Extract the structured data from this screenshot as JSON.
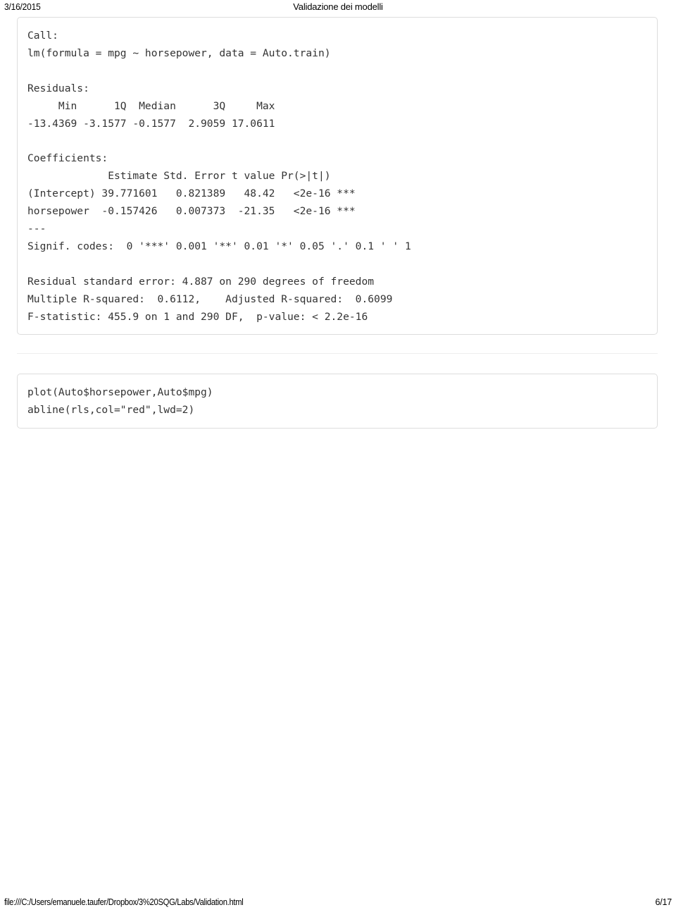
{
  "header": {
    "date": "3/16/2015",
    "title": "Validazione dei modelli"
  },
  "blocks": {
    "regression_output": "Call:\nlm(formula = mpg ~ horsepower, data = Auto.train)\n\nResiduals:\n     Min      1Q  Median      3Q     Max \n-13.4369 -3.1577 -0.1577  2.9059 17.0611 \n\nCoefficients:\n             Estimate Std. Error t value Pr(>|t|)    \n(Intercept) 39.771601   0.821389   48.42   <2e-16 ***\nhorsepower  -0.157426   0.007373  -21.35   <2e-16 ***\n---\nSignif. codes:  0 '***' 0.001 '**' 0.01 '*' 0.05 '.' 0.1 ' ' 1\n\nResidual standard error: 4.887 on 290 degrees of freedom\nMultiple R-squared:  0.6112,\tAdjusted R-squared:  0.6099 \nF-statistic: 455.9 on 1 and 290 DF,  p-value: < 2.2e-16",
    "plot_code": "plot(Auto$horsepower,Auto$mpg)\nabline(rls,col=\"red\",lwd=2)"
  },
  "footer": {
    "url": "file:///C:/Users/emanuele.taufer/Dropbox/3%20SQG/Labs/Validation.html",
    "page": "6/17"
  },
  "colors": {
    "code_text": "#333333",
    "block_border": "#dddddd",
    "rule": "#eeeeee",
    "page_text": "#000000",
    "background": "#ffffff"
  }
}
